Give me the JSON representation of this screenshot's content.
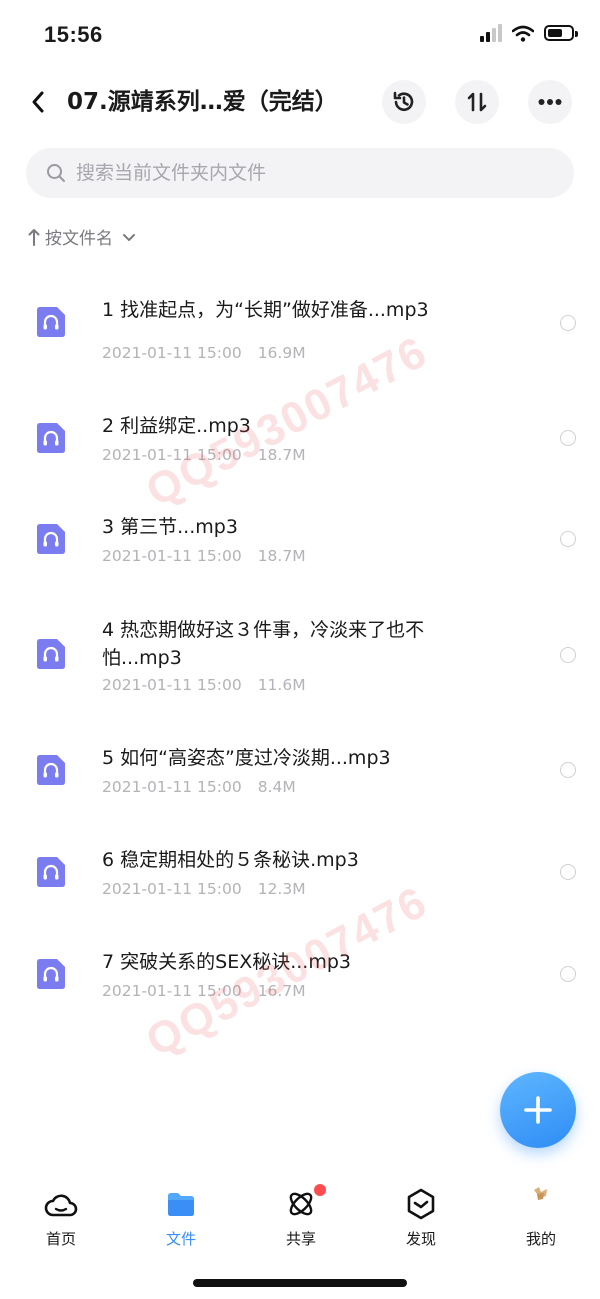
{
  "status_bar": {
    "time": "15:56"
  },
  "header": {
    "title": "07.源靖系列…爱（完结）"
  },
  "search": {
    "placeholder": "搜索当前文件夹内文件"
  },
  "sort": {
    "label": "按文件名"
  },
  "files": [
    {
      "name": "1 找准起点，为“长期”做好准备...mp3",
      "date": "2021-01-11 15:00",
      "size": "16.9M"
    },
    {
      "name": "2 利益绑定..mp3",
      "date": "2021-01-11 15:00",
      "size": "18.7M"
    },
    {
      "name": "3 第三节...mp3",
      "date": "2021-01-11 15:00",
      "size": "18.7M"
    },
    {
      "name": "4 热恋期做好这３件事，冷淡来了也不怕...mp3",
      "date": "2021-01-11 15:00",
      "size": "11.6M"
    },
    {
      "name": "5 如何“高姿态”度过冷淡期...mp3",
      "date": "2021-01-11 15:00",
      "size": "8.4M"
    },
    {
      "name": "6 稳定期相处的５条秘诀.mp3",
      "date": "2021-01-11 15:00",
      "size": "12.3M"
    },
    {
      "name": "7 突破关系的SEX秘诀...mp3",
      "date": "2021-01-11 15:00",
      "size": "16.7M"
    }
  ],
  "watermark": {
    "text": "QQ593007476"
  },
  "tabs": [
    {
      "label": "首页",
      "icon": "cloud-icon"
    },
    {
      "label": "文件",
      "icon": "folder-icon",
      "active": true
    },
    {
      "label": "共享",
      "icon": "atom-icon",
      "badge": true
    },
    {
      "label": "发现",
      "icon": "discover-icon"
    },
    {
      "label": "我的",
      "icon": "avatar-icon"
    }
  ],
  "colors": {
    "accent": "#3a8ef6",
    "file_icon": "#7b7cf0",
    "badge": "#ff4d4f",
    "watermark": "#eb5a5a"
  }
}
